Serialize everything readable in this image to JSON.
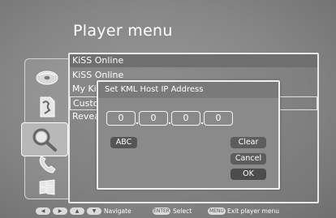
{
  "header": {
    "title": "Player menu"
  },
  "sidebar": {
    "icons": [
      {
        "name": "disc-icon"
      },
      {
        "name": "document-icon"
      },
      {
        "name": "magnifier-icon"
      },
      {
        "name": "phone-icon"
      },
      {
        "name": "windows-icon"
      }
    ],
    "selected_index": 2
  },
  "menu": {
    "header": "KiSS Online",
    "items": [
      "KiSS Online",
      "My Kiss",
      "Custo",
      "Revea"
    ],
    "highlighted_index": 2
  },
  "dialog": {
    "title": "Set KML Host IP Address",
    "ip_octets": [
      "0",
      "0",
      "0",
      "0"
    ],
    "abc_label": "ABC",
    "clear_label": "Clear",
    "cancel_label": "Cancel",
    "ok_label": "OK"
  },
  "legend": {
    "navigate_label": "Navigate",
    "select_key": "ENTER",
    "select_label": "Select",
    "menu_key": "MENU",
    "exit_label": "Exit player menu"
  }
}
